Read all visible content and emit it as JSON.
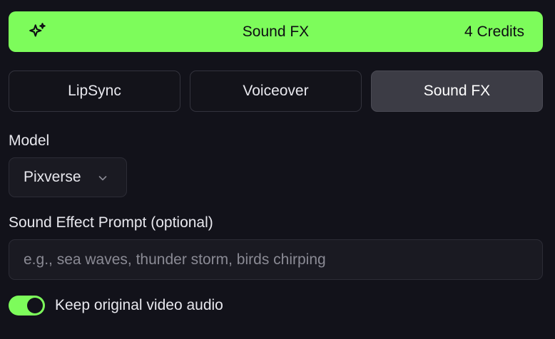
{
  "generate": {
    "label": "Sound FX",
    "credits": "4 Credits",
    "icon": "sparkles-icon",
    "color": "#7dfc5b"
  },
  "tabs": [
    {
      "label": "LipSync",
      "active": false
    },
    {
      "label": "Voiceover",
      "active": false
    },
    {
      "label": "Sound FX",
      "active": true
    }
  ],
  "model": {
    "label": "Model",
    "selected": "Pixverse"
  },
  "prompt": {
    "label": "Sound Effect Prompt (optional)",
    "value": "",
    "placeholder": "e.g., sea waves, thunder storm, birds chirping"
  },
  "keep_audio": {
    "label": "Keep original video audio",
    "enabled": true
  }
}
